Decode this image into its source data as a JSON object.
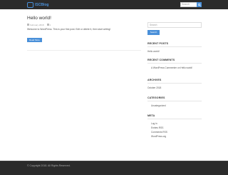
{
  "header": {
    "logo_text": "ISCBlog",
    "search_placeholder": "Search"
  },
  "post": {
    "title": "Hello world!",
    "date": "February 2018",
    "comments": "1",
    "excerpt": "Welcome to WordPress. This is your first post. Edit or delete it, then start writing!",
    "read_more": "Read More"
  },
  "sidebar": {
    "search_placeholder": "Search",
    "search_button": "Search",
    "recent_posts": {
      "title": "RECENT POSTS",
      "items": [
        "Hello world!"
      ]
    },
    "recent_comments": {
      "title": "RECENT COMMENTS",
      "items": [
        "A WordPress Commenter on Hello world!"
      ]
    },
    "archives": {
      "title": "ARCHIVES",
      "items": [
        "October 2018"
      ]
    },
    "categories": {
      "title": "CATEGORIES",
      "items": [
        "Uncategorized"
      ]
    },
    "meta": {
      "title": "META",
      "items": [
        "Log in",
        "Entries RSS",
        "Comments RSS",
        "WordPress.org"
      ]
    }
  },
  "footer": {
    "copyright": "© Copyright 2018. All Rights Reserved."
  },
  "colors": {
    "accent": "#4a90d9",
    "header_bg": "#2b2b2b",
    "footer_bg": "#2b2b2b"
  }
}
